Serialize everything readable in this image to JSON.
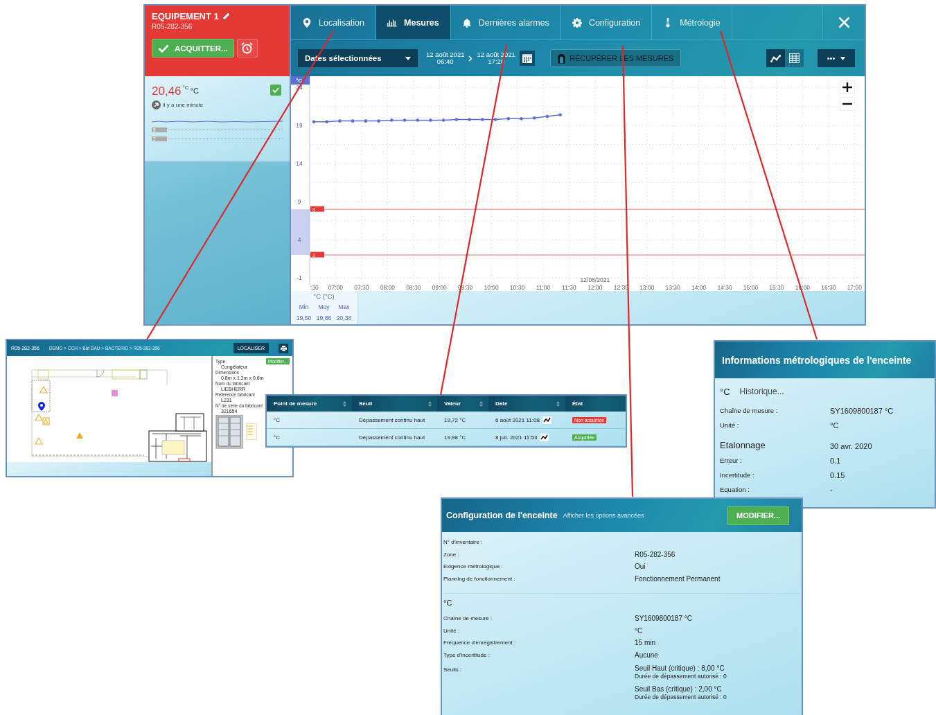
{
  "equipment": {
    "title": "EQUIPEMENT 1",
    "code": "R05-282-356",
    "acknowledge_button": "ACQUITTER...",
    "reading": {
      "value": "20,46",
      "unit_sup": "°C",
      "unit": "°C",
      "time": "il y a une minute",
      "ok": true
    },
    "thresholds": [
      "8",
      "2"
    ]
  },
  "tabs": [
    {
      "label": "Localisation",
      "kind": "pin",
      "selected": false
    },
    {
      "label": "Mesures",
      "kind": "bars",
      "selected": true
    },
    {
      "label": "Dernières alarmes",
      "kind": "bell",
      "selected": false
    },
    {
      "label": "Configuration",
      "kind": "gear",
      "selected": false
    },
    {
      "label": "Métrologie",
      "kind": "thermometer",
      "selected": false
    }
  ],
  "toolbar": {
    "period": "Dates sélectionnées",
    "from_date": "12 août 2021",
    "from_time": "06:40",
    "to_date": "12 août 2021",
    "to_time": "17:20",
    "fetch_button": "RÉCUPÉRER LES MESURES",
    "views": [
      {
        "kind": "chart",
        "selected": true
      },
      {
        "kind": "table",
        "selected": false
      }
    ],
    "more": "•••"
  },
  "chart": {
    "date_label": "12/08/2021",
    "cut_tick_label": ":30",
    "chart_data": {
      "type": "line",
      "grid": true,
      "x": [
        6.58,
        6.83,
        7.08,
        7.33,
        7.58,
        7.83,
        8.08,
        8.33,
        8.58,
        8.83,
        9.08,
        9.33,
        9.58,
        9.83,
        10.08,
        10.33,
        10.58,
        10.83,
        11.08,
        11.33
      ],
      "series": [
        {
          "name": "°C",
          "color": "#5a6fd0",
          "values": [
            19.5,
            19.5,
            19.6,
            19.6,
            19.6,
            19.6,
            19.7,
            19.7,
            19.7,
            19.7,
            19.7,
            19.8,
            19.8,
            19.8,
            19.8,
            19.9,
            19.9,
            20,
            20.2,
            20.4
          ]
        }
      ],
      "xlim": [
        6.5,
        17.17
      ],
      "ylim": [
        -2,
        25.3
      ],
      "xticks": [
        {
          "value": 7,
          "label": "07:00"
        },
        {
          "value": 7.5,
          "label": "07:30"
        },
        {
          "value": 8,
          "label": "08:00"
        },
        {
          "value": 8.5,
          "label": "08:30"
        },
        {
          "value": 9,
          "label": "09:00"
        },
        {
          "value": 9.5,
          "label": "09:30"
        },
        {
          "value": 10,
          "label": "10:00"
        },
        {
          "value": 10.5,
          "label": "10:30"
        },
        {
          "value": 11,
          "label": "11:00"
        },
        {
          "value": 11.5,
          "label": "11:30"
        },
        {
          "value": 12,
          "label": "12:00"
        },
        {
          "value": 12.5,
          "label": "12:30"
        },
        {
          "value": 13,
          "label": "13:00"
        },
        {
          "value": 13.5,
          "label": "13:30"
        },
        {
          "value": 14,
          "label": "14:00"
        },
        {
          "value": 14.5,
          "label": "14:30"
        },
        {
          "value": 15,
          "label": "15:00"
        },
        {
          "value": 15.5,
          "label": "15:30"
        },
        {
          "value": 16,
          "label": "16:00"
        },
        {
          "value": 16.5,
          "label": "16:30"
        },
        {
          "value": 17,
          "label": "17:00"
        }
      ],
      "yticks": [
        -1,
        4,
        9,
        14,
        19,
        24
      ],
      "ref_lines": [
        {
          "axis": "y",
          "value": 8,
          "label": "8",
          "color": "#e57373"
        },
        {
          "axis": "y",
          "value": 2,
          "label": "2",
          "color": "#e57373"
        }
      ]
    }
  },
  "stats": {
    "series": "°C (°C)",
    "labels": [
      "Min",
      "Moy",
      "Max"
    ],
    "values": [
      "19,50",
      "19,86",
      "20,38"
    ]
  },
  "localisation": {
    "code": "R05-282-356",
    "breadcrumb": "DEMO > CCH > Bât DAU > BACTERIO > R05-282-356",
    "locate_button": "LOCALISER",
    "edit_button": "Modifier...",
    "fields": [
      {
        "label": "Type",
        "value": "Congélateur"
      },
      {
        "label": "Dimensions",
        "value": "0.8m x 1.2m x 0.6m"
      },
      {
        "label": "Nom du fabricant",
        "value": "LIEBHERR"
      },
      {
        "label": "Référence fabricant",
        "value": "L231"
      },
      {
        "label": "N° de série du fabricant",
        "value": "321654"
      }
    ]
  },
  "alarms": {
    "columns": [
      {
        "label": "Point de mesure",
        "sortable": true
      },
      {
        "label": "Seuil",
        "sortable": true
      },
      {
        "label": "Valeur",
        "sortable": true
      },
      {
        "label": "Date",
        "sortable": true
      },
      {
        "label": "État",
        "sortable": false
      }
    ],
    "rows": [
      {
        "point": "°C",
        "threshold": "Dépassement continu haut",
        "value": "19,72 °C",
        "date": "6 août 2021 11:08",
        "state": "Non acquittée",
        "acknowledged": false
      },
      {
        "point": "°C",
        "threshold": "Dépassement continu haut",
        "value": "19,98 °C",
        "date": "8 juil. 2021 11:53",
        "state": "Acquittée",
        "acknowledged": true
      }
    ]
  },
  "metrology": {
    "title": "Informations métrologiques de l'enceinte",
    "unit": "°C",
    "history_link": "Historique...",
    "rows": [
      {
        "label": "Chaîne de mesure :",
        "value": "SY1609800187 °C"
      },
      {
        "label": "Unité :",
        "value": "°C"
      }
    ],
    "calibration": {
      "title": "Etalonnage",
      "date": "30 avr. 2020"
    },
    "calibration_rows": [
      {
        "label": "Erreur :",
        "value": "0.1"
      },
      {
        "label": "Incertitude :",
        "value": "0.15"
      },
      {
        "label": "Equation :",
        "value": "-"
      }
    ]
  },
  "configuration": {
    "title": "Configuration de l'enceinte",
    "advanced_link": "Afficher les options avancées",
    "edit_button": "MODIFIER...",
    "rows": [
      {
        "label": "N° d'inventaire :",
        "value": ""
      },
      {
        "label": "Zone :",
        "value": "R05-282-356"
      },
      {
        "label": "Exigence métrologique :",
        "value": "Oui"
      },
      {
        "label": "Planning de fonctionnement :",
        "value": "Fonctionnement Permanent"
      }
    ],
    "sensor": "°C",
    "sensor_rows": [
      {
        "label": "Chaîne de mesure :",
        "value": "SY1609800187 °C"
      },
      {
        "label": "Unité :",
        "value": "°C"
      },
      {
        "label": "Fréquence d'enregistrement :",
        "value": "15 min"
      },
      {
        "label": "Type d'incertitude :",
        "value": "Aucune"
      }
    ],
    "thresholds_label": "Seuils :",
    "thresholds": [
      {
        "title": "Seuil Haut (critique) : 8,00 °C",
        "detail": "Durée de dépassement autorisé : 0"
      },
      {
        "title": "Seuil Bas (critique) : 2,00 °C",
        "detail": "Durée de dépassement autorisé : 0"
      }
    ]
  }
}
